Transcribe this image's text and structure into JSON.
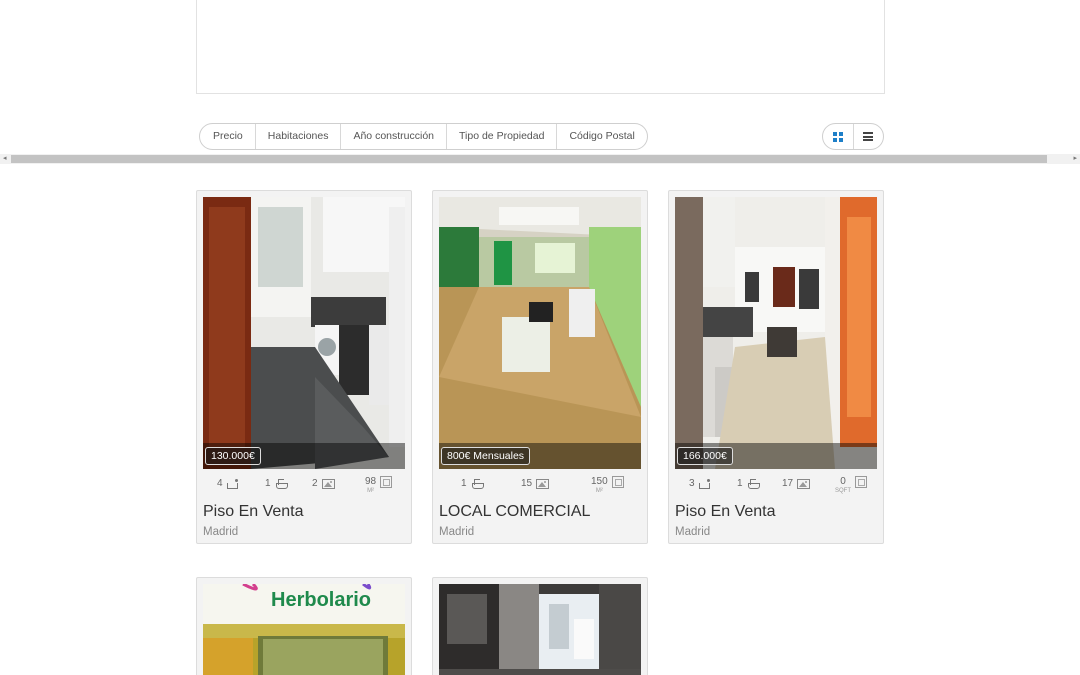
{
  "sort_bar": [
    "Precio",
    "Habitaciones",
    "Año construcción",
    "Tipo de Propiedad",
    "Código Postal"
  ],
  "view_toggle": {
    "grid": "grid-view-icon",
    "list": "list-view-icon"
  },
  "listings": [
    {
      "price": "130.000€",
      "beds": "4",
      "baths": "1",
      "photos": "2",
      "area": "98",
      "area_unit": "M²",
      "title": "Piso En Venta",
      "city": "Madrid"
    },
    {
      "price": "800€ Mensuales",
      "baths": "1",
      "photos": "15",
      "area": "150",
      "area_unit": "M²",
      "title": "LOCAL COMERCIAL",
      "city": "Madrid"
    },
    {
      "price": "166.000€",
      "beds": "3",
      "baths": "1",
      "photos": "17",
      "area": "0",
      "area_unit": "SQFT",
      "title": "Piso En Venta",
      "city": "Madrid"
    }
  ],
  "partial_listings": [
    {
      "sign_text": "Herbolario"
    },
    {}
  ],
  "colors": {
    "accent": "#1e7fc8",
    "card_bg": "#f3f3f3"
  }
}
